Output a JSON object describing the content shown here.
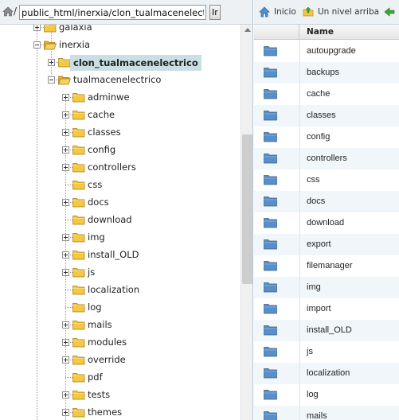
{
  "path_bar": {
    "separator": "/",
    "path_value": "public_html/inerxia/clon_tualmacenelectrico",
    "go_label": "Ir"
  },
  "tree": {
    "nodes": [
      {
        "label": "galaxia",
        "expander": "plus",
        "selected": false
      },
      {
        "label": "inerxia",
        "expander": "minus",
        "selected": false
      },
      {
        "label": "clon_tualmacenelectrico",
        "expander": "plus",
        "selected": true
      },
      {
        "label": "tualmacenelectrico",
        "expander": "minus",
        "selected": false
      },
      {
        "label": "adminwe",
        "expander": "plus",
        "selected": false
      },
      {
        "label": "cache",
        "expander": "plus",
        "selected": false
      },
      {
        "label": "classes",
        "expander": "plus",
        "selected": false
      },
      {
        "label": "config",
        "expander": "plus",
        "selected": false
      },
      {
        "label": "controllers",
        "expander": "plus",
        "selected": false
      },
      {
        "label": "css",
        "expander": "none",
        "selected": false
      },
      {
        "label": "docs",
        "expander": "plus",
        "selected": false
      },
      {
        "label": "download",
        "expander": "none",
        "selected": false
      },
      {
        "label": "img",
        "expander": "plus",
        "selected": false
      },
      {
        "label": "install_OLD",
        "expander": "plus",
        "selected": false
      },
      {
        "label": "js",
        "expander": "plus",
        "selected": false
      },
      {
        "label": "localization",
        "expander": "none",
        "selected": false
      },
      {
        "label": "log",
        "expander": "none",
        "selected": false
      },
      {
        "label": "mails",
        "expander": "plus",
        "selected": false
      },
      {
        "label": "modules",
        "expander": "plus",
        "selected": false
      },
      {
        "label": "override",
        "expander": "plus",
        "selected": false
      },
      {
        "label": "pdf",
        "expander": "none",
        "selected": false
      },
      {
        "label": "tests",
        "expander": "plus",
        "selected": false
      },
      {
        "label": "themes",
        "expander": "plus",
        "selected": false
      }
    ]
  },
  "toolbar": {
    "home_label": "Inicio",
    "up_label": "Un nivel arriba"
  },
  "file_list": {
    "column_name": "Name",
    "items": [
      "autoupgrade",
      "backups",
      "cache",
      "classes",
      "config",
      "controllers",
      "css",
      "docs",
      "download",
      "export",
      "filemanager",
      "img",
      "import",
      "install_OLD",
      "js",
      "localization",
      "log",
      "mails"
    ]
  },
  "colors": {
    "selected_bg": "#c9dfe3",
    "folder_yellow": "#f5c842",
    "folder_blue": "#5a8ec6",
    "alt_row": "#f1f6fa"
  }
}
